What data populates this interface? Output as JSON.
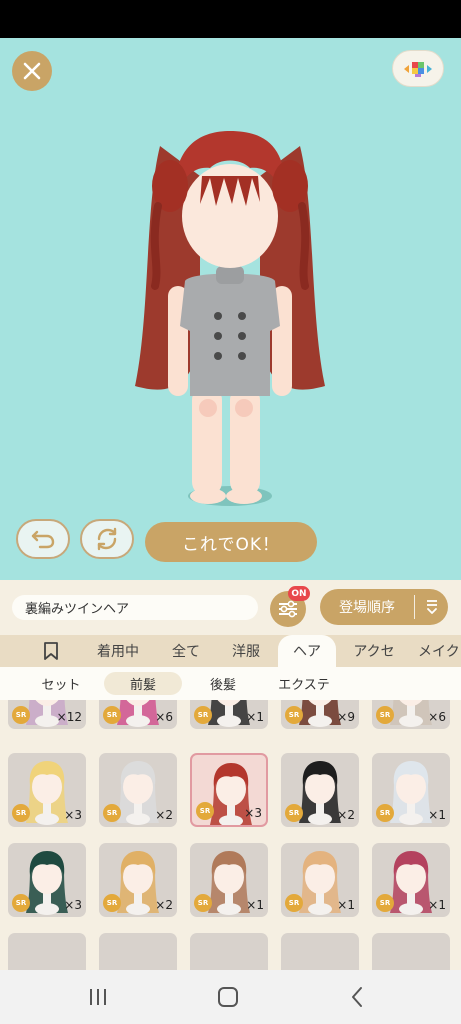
{
  "stage": {
    "close_icon": "close-icon",
    "background_switch_icon": "color-palette-icon",
    "ok_label": "これでOK！"
  },
  "panel": {
    "item_name": "裏編みツインヘア",
    "filter_badge": "ON",
    "sort_label": "登場順序",
    "tabs": [
      {
        "label": "",
        "icon": "bookmark-icon"
      },
      {
        "label": "着用中"
      },
      {
        "label": "全て"
      },
      {
        "label": "洋服"
      },
      {
        "label": "ヘア"
      },
      {
        "label": "アクセ"
      },
      {
        "label": "メイク"
      }
    ],
    "active_tab": "ヘア",
    "subtabs": [
      "セット",
      "前髪",
      "後髪",
      "エクステ"
    ],
    "active_subtab": "前髪",
    "rarity": "SR",
    "items": [
      {
        "rarity": "SR",
        "qty": "×12",
        "hair": "#c9a8c8"
      },
      {
        "rarity": "SR",
        "qty": "×6",
        "hair": "#d2558f"
      },
      {
        "rarity": "SR",
        "qty": "×1",
        "hair": "#2b2b2b"
      },
      {
        "rarity": "SR",
        "qty": "×9",
        "hair": "#6b3426"
      },
      {
        "rarity": "SR",
        "qty": "×6",
        "hair": "#cfc3b6"
      },
      {
        "rarity": "SR",
        "qty": "×3",
        "hair": "#f0d37a"
      },
      {
        "rarity": "SR",
        "qty": "×2",
        "hair": "#dcdcdc"
      },
      {
        "rarity": "SR",
        "qty": "×3",
        "hair": "#b3372d"
      },
      {
        "rarity": "SR",
        "qty": "×2",
        "hair": "#1e1e1e"
      },
      {
        "rarity": "SR",
        "qty": "×1",
        "hair": "#dfe6ec"
      },
      {
        "rarity": "SR",
        "qty": "×3",
        "hair": "#1f4a40"
      },
      {
        "rarity": "SR",
        "qty": "×2",
        "hair": "#e0b065"
      },
      {
        "rarity": "SR",
        "qty": "×1",
        "hair": "#b07a5a"
      },
      {
        "rarity": "SR",
        "qty": "×1",
        "hair": "#e4b37f"
      },
      {
        "rarity": "SR",
        "qty": "×1",
        "hair": "#b4425e"
      }
    ],
    "selected_index": 7
  },
  "colors": {
    "accent": "#c9a466",
    "stage_bg": "#a5e3df",
    "panel_bg": "#f5efe2",
    "badge_red": "#e8474b",
    "selected_border": "#e19aa1"
  },
  "navbar": {
    "recent_icon": "recent-apps-icon",
    "home_icon": "home-icon",
    "back_icon": "back-icon"
  }
}
